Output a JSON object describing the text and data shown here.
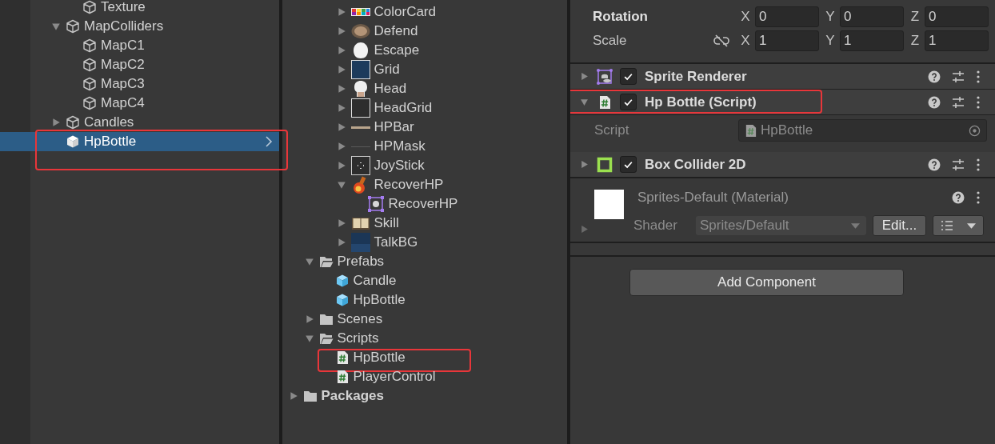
{
  "hierarchy": {
    "items": [
      {
        "children": [
          {
            "name": "Texture",
            "kind": "gameobject",
            "selected": false
          }
        ]
      },
      {
        "name": "MapColliders",
        "kind": "gameobject",
        "expanded": true,
        "selected": false,
        "children": [
          {
            "name": "MapC1",
            "kind": "gameobject",
            "selected": false
          },
          {
            "name": "MapC2",
            "kind": "gameobject",
            "selected": false
          },
          {
            "name": "MapC3",
            "kind": "gameobject",
            "selected": false
          },
          {
            "name": "MapC4",
            "kind": "gameobject",
            "selected": false
          }
        ]
      },
      {
        "name": "Candles",
        "kind": "gameobject",
        "expanded": false,
        "selected": false
      },
      {
        "name": "HpBottle",
        "kind": "prefab-instance",
        "selected": true,
        "highlighted": true
      }
    ]
  },
  "project": {
    "items": [
      {
        "children": [
          {
            "children": [
              {
                "children": [
                  {
                    "name": "ColorCard",
                    "kind": "sprite",
                    "expanded": false
                  },
                  {
                    "name": "Defend",
                    "kind": "sprite",
                    "expanded": false
                  },
                  {
                    "name": "Escape",
                    "kind": "sprite",
                    "expanded": false
                  },
                  {
                    "name": "Grid",
                    "kind": "sprite",
                    "expanded": false
                  },
                  {
                    "name": "Head",
                    "kind": "sprite",
                    "expanded": false
                  },
                  {
                    "name": "HeadGrid",
                    "kind": "sprite",
                    "expanded": false
                  },
                  {
                    "name": "HPBar",
                    "kind": "sprite",
                    "expanded": false
                  },
                  {
                    "name": "HPMask",
                    "kind": "sprite",
                    "expanded": false
                  },
                  {
                    "name": "JoyStick",
                    "kind": "sprite",
                    "expanded": false
                  },
                  {
                    "name": "RecoverHP",
                    "kind": "sprite",
                    "expanded": true,
                    "children": [
                      {
                        "name": "RecoverHP",
                        "kind": "subsprite"
                      }
                    ]
                  },
                  {
                    "name": "Skill",
                    "kind": "sprite",
                    "expanded": false
                  },
                  {
                    "name": "TalkBG",
                    "kind": "sprite",
                    "expanded": false
                  }
                ]
              }
            ]
          },
          {
            "name": "Prefabs",
            "kind": "folder",
            "expanded": true,
            "children": [
              {
                "name": "Candle",
                "kind": "prefab"
              },
              {
                "name": "HpBottle",
                "kind": "prefab"
              }
            ]
          },
          {
            "name": "Scenes",
            "kind": "folder",
            "expanded": false
          },
          {
            "name": "Scripts",
            "kind": "folder",
            "expanded": true,
            "children": [
              {
                "name": "HpBottle",
                "kind": "script",
                "highlighted": true
              },
              {
                "name": "PlayerControl",
                "kind": "script"
              }
            ]
          }
        ]
      },
      {
        "name": "Packages",
        "kind": "folder",
        "expanded": false
      }
    ]
  },
  "inspector": {
    "transform": [
      {
        "label": "Rotation",
        "overridden": true,
        "values": [
          {
            "axis": "X",
            "value": "0"
          },
          {
            "axis": "Y",
            "value": "0"
          },
          {
            "axis": "Z",
            "value": "0"
          }
        ]
      },
      {
        "label": "Scale",
        "overridden": false,
        "constrained": false,
        "values": [
          {
            "axis": "X",
            "value": "1"
          },
          {
            "axis": "Y",
            "value": "1"
          },
          {
            "axis": "Z",
            "value": "1"
          }
        ]
      }
    ],
    "components": [
      {
        "name": "Sprite Renderer",
        "kind": "sprite-renderer",
        "enabled": true,
        "expanded": false
      },
      {
        "name": "Hp Bottle (Script)",
        "kind": "script",
        "enabled": true,
        "expanded": true,
        "highlighted": true,
        "fields": [
          {
            "label": "Script",
            "value": "HpBottle",
            "kind": "script-reference",
            "disabled": true
          }
        ]
      },
      {
        "name": "Box Collider 2D",
        "kind": "box-collider",
        "enabled": true,
        "expanded": false
      }
    ],
    "material": {
      "name": "Sprites-Default (Material)",
      "expanded": false,
      "shader_label": "Shader",
      "shader": "Sprites/Default",
      "edit_button": "Edit..."
    },
    "add_component": "Add Component"
  }
}
